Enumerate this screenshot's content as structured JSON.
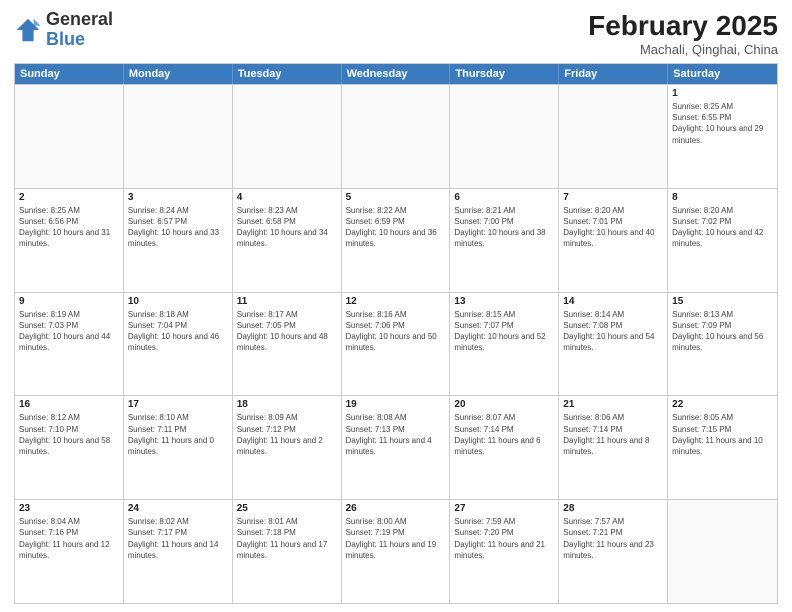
{
  "logo": {
    "general": "General",
    "blue": "Blue"
  },
  "header": {
    "title": "February 2025",
    "subtitle": "Machali, Qinghai, China"
  },
  "weekdays": [
    "Sunday",
    "Monday",
    "Tuesday",
    "Wednesday",
    "Thursday",
    "Friday",
    "Saturday"
  ],
  "weeks": [
    [
      {
        "day": "",
        "sunrise": "",
        "sunset": "",
        "daylight": ""
      },
      {
        "day": "",
        "sunrise": "",
        "sunset": "",
        "daylight": ""
      },
      {
        "day": "",
        "sunrise": "",
        "sunset": "",
        "daylight": ""
      },
      {
        "day": "",
        "sunrise": "",
        "sunset": "",
        "daylight": ""
      },
      {
        "day": "",
        "sunrise": "",
        "sunset": "",
        "daylight": ""
      },
      {
        "day": "",
        "sunrise": "",
        "sunset": "",
        "daylight": ""
      },
      {
        "day": "1",
        "sunrise": "Sunrise: 8:25 AM",
        "sunset": "Sunset: 6:55 PM",
        "daylight": "Daylight: 10 hours and 29 minutes."
      }
    ],
    [
      {
        "day": "2",
        "sunrise": "Sunrise: 8:25 AM",
        "sunset": "Sunset: 6:56 PM",
        "daylight": "Daylight: 10 hours and 31 minutes."
      },
      {
        "day": "3",
        "sunrise": "Sunrise: 8:24 AM",
        "sunset": "Sunset: 6:57 PM",
        "daylight": "Daylight: 10 hours and 33 minutes."
      },
      {
        "day": "4",
        "sunrise": "Sunrise: 8:23 AM",
        "sunset": "Sunset: 6:58 PM",
        "daylight": "Daylight: 10 hours and 34 minutes."
      },
      {
        "day": "5",
        "sunrise": "Sunrise: 8:22 AM",
        "sunset": "Sunset: 6:59 PM",
        "daylight": "Daylight: 10 hours and 36 minutes."
      },
      {
        "day": "6",
        "sunrise": "Sunrise: 8:21 AM",
        "sunset": "Sunset: 7:00 PM",
        "daylight": "Daylight: 10 hours and 38 minutes."
      },
      {
        "day": "7",
        "sunrise": "Sunrise: 8:20 AM",
        "sunset": "Sunset: 7:01 PM",
        "daylight": "Daylight: 10 hours and 40 minutes."
      },
      {
        "day": "8",
        "sunrise": "Sunrise: 8:20 AM",
        "sunset": "Sunset: 7:02 PM",
        "daylight": "Daylight: 10 hours and 42 minutes."
      }
    ],
    [
      {
        "day": "9",
        "sunrise": "Sunrise: 8:19 AM",
        "sunset": "Sunset: 7:03 PM",
        "daylight": "Daylight: 10 hours and 44 minutes."
      },
      {
        "day": "10",
        "sunrise": "Sunrise: 8:18 AM",
        "sunset": "Sunset: 7:04 PM",
        "daylight": "Daylight: 10 hours and 46 minutes."
      },
      {
        "day": "11",
        "sunrise": "Sunrise: 8:17 AM",
        "sunset": "Sunset: 7:05 PM",
        "daylight": "Daylight: 10 hours and 48 minutes."
      },
      {
        "day": "12",
        "sunrise": "Sunrise: 8:16 AM",
        "sunset": "Sunset: 7:06 PM",
        "daylight": "Daylight: 10 hours and 50 minutes."
      },
      {
        "day": "13",
        "sunrise": "Sunrise: 8:15 AM",
        "sunset": "Sunset: 7:07 PM",
        "daylight": "Daylight: 10 hours and 52 minutes."
      },
      {
        "day": "14",
        "sunrise": "Sunrise: 8:14 AM",
        "sunset": "Sunset: 7:08 PM",
        "daylight": "Daylight: 10 hours and 54 minutes."
      },
      {
        "day": "15",
        "sunrise": "Sunrise: 8:13 AM",
        "sunset": "Sunset: 7:09 PM",
        "daylight": "Daylight: 10 hours and 56 minutes."
      }
    ],
    [
      {
        "day": "16",
        "sunrise": "Sunrise: 8:12 AM",
        "sunset": "Sunset: 7:10 PM",
        "daylight": "Daylight: 10 hours and 58 minutes."
      },
      {
        "day": "17",
        "sunrise": "Sunrise: 8:10 AM",
        "sunset": "Sunset: 7:11 PM",
        "daylight": "Daylight: 11 hours and 0 minutes."
      },
      {
        "day": "18",
        "sunrise": "Sunrise: 8:09 AM",
        "sunset": "Sunset: 7:12 PM",
        "daylight": "Daylight: 11 hours and 2 minutes."
      },
      {
        "day": "19",
        "sunrise": "Sunrise: 8:08 AM",
        "sunset": "Sunset: 7:13 PM",
        "daylight": "Daylight: 11 hours and 4 minutes."
      },
      {
        "day": "20",
        "sunrise": "Sunrise: 8:07 AM",
        "sunset": "Sunset: 7:14 PM",
        "daylight": "Daylight: 11 hours and 6 minutes."
      },
      {
        "day": "21",
        "sunrise": "Sunrise: 8:06 AM",
        "sunset": "Sunset: 7:14 PM",
        "daylight": "Daylight: 11 hours and 8 minutes."
      },
      {
        "day": "22",
        "sunrise": "Sunrise: 8:05 AM",
        "sunset": "Sunset: 7:15 PM",
        "daylight": "Daylight: 11 hours and 10 minutes."
      }
    ],
    [
      {
        "day": "23",
        "sunrise": "Sunrise: 8:04 AM",
        "sunset": "Sunset: 7:16 PM",
        "daylight": "Daylight: 11 hours and 12 minutes."
      },
      {
        "day": "24",
        "sunrise": "Sunrise: 8:02 AM",
        "sunset": "Sunset: 7:17 PM",
        "daylight": "Daylight: 11 hours and 14 minutes."
      },
      {
        "day": "25",
        "sunrise": "Sunrise: 8:01 AM",
        "sunset": "Sunset: 7:18 PM",
        "daylight": "Daylight: 11 hours and 17 minutes."
      },
      {
        "day": "26",
        "sunrise": "Sunrise: 8:00 AM",
        "sunset": "Sunset: 7:19 PM",
        "daylight": "Daylight: 11 hours and 19 minutes."
      },
      {
        "day": "27",
        "sunrise": "Sunrise: 7:59 AM",
        "sunset": "Sunset: 7:20 PM",
        "daylight": "Daylight: 11 hours and 21 minutes."
      },
      {
        "day": "28",
        "sunrise": "Sunrise: 7:57 AM",
        "sunset": "Sunset: 7:21 PM",
        "daylight": "Daylight: 11 hours and 23 minutes."
      },
      {
        "day": "",
        "sunrise": "",
        "sunset": "",
        "daylight": ""
      }
    ]
  ]
}
